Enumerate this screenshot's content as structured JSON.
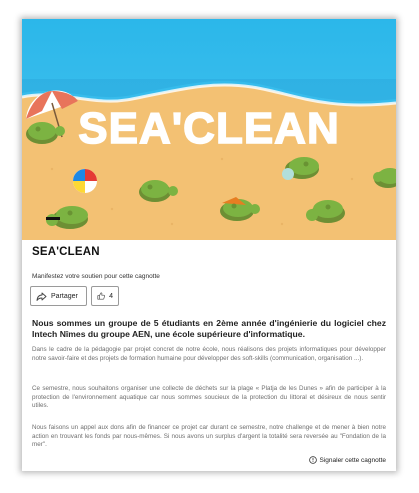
{
  "hero": {
    "banner_text": "SEA'CLEAN"
  },
  "campaign": {
    "title": "SEA'CLEAN",
    "support_text": "Manifestez votre soutien pour cette cagnotte",
    "share_label": "Partager",
    "like_count": "4",
    "headline": "Nous sommes un groupe de 5 étudiants en 2ème année d'ingénierie du logiciel chez Intech Nîmes du groupe AEN, une école supérieure d'informatique.",
    "paragraphs": [
      "Dans le cadre de la pédagogie par projet concret de notre école, nous réalisons des projets informatiques pour développer notre savoir-faire et des projets de formation humaine pour développer des soft-skills (communication, organisation ...).",
      "Ce semestre, nous souhaitons organiser une collecte de déchets sur la plage « Platja de les Dunes » afin de participer à la protection de l'environnement aquatique car nous sommes soucieux de la protection du littoral et désireux de nous sentir utiles.",
      "Nous faisons un appel aux dons afin de financer ce projet car durant ce semestre, notre challenge et de mener à bien notre action en trouvant les fonds par nous-mêmes. Si nous avons un surplus d'argent la totalité sera reversée au \"Fondation de la mer\"."
    ],
    "report_label": "Signaler cette cagnotte"
  },
  "colors": {
    "sky": "#29b6e8",
    "sand": "#f3c173",
    "turtle": "#7cb342"
  },
  "icons": [
    "share-icon",
    "thumbs-up-icon",
    "info-circle-icon"
  ]
}
